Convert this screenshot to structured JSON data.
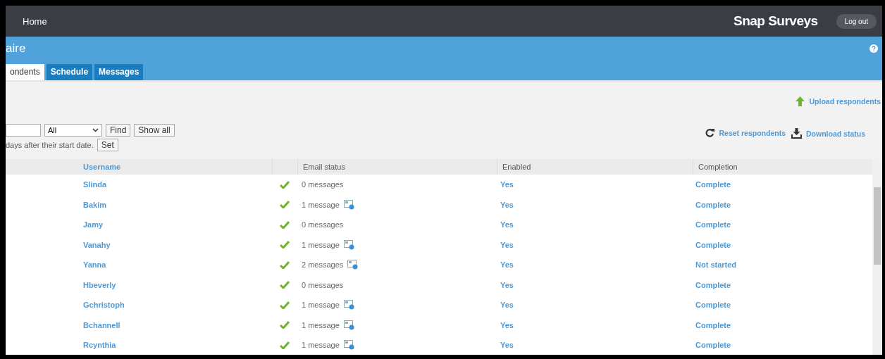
{
  "header": {
    "home": "Home",
    "brand": "Snap Surveys",
    "logout": "Log out"
  },
  "banner": {
    "title": "aire"
  },
  "tabs": [
    {
      "label": "ondents",
      "selected": true
    },
    {
      "label": "Schedule",
      "selected": false
    },
    {
      "label": "Messages",
      "selected": false
    }
  ],
  "actions": {
    "upload": "Upload respondents",
    "reset": "Reset respondents",
    "download": "Download status"
  },
  "filter": {
    "select_value": "All",
    "find": "Find",
    "show_all": "Show all",
    "days_text": "days after their start date.",
    "set": "Set"
  },
  "table": {
    "columns": [
      "Username",
      "Email status",
      "Enabled",
      "Completion"
    ],
    "rows": [
      {
        "username": "Slinda",
        "valid": true,
        "email_status": "0 messages",
        "has_message_icon": false,
        "enabled": "Yes",
        "completion": "Complete"
      },
      {
        "username": "Bakim",
        "valid": true,
        "email_status": "1 message",
        "has_message_icon": true,
        "enabled": "Yes",
        "completion": "Complete"
      },
      {
        "username": "Jamy",
        "valid": true,
        "email_status": "0 messages",
        "has_message_icon": false,
        "enabled": "Yes",
        "completion": "Complete"
      },
      {
        "username": "Vanahy",
        "valid": true,
        "email_status": "1 message",
        "has_message_icon": true,
        "enabled": "Yes",
        "completion": "Complete"
      },
      {
        "username": "Yanna",
        "valid": true,
        "email_status": "2 messages",
        "has_message_icon": true,
        "enabled": "Yes",
        "completion": "Not started"
      },
      {
        "username": "Hbeverly",
        "valid": true,
        "email_status": "0 messages",
        "has_message_icon": false,
        "enabled": "Yes",
        "completion": "Complete"
      },
      {
        "username": "Gchristoph",
        "valid": true,
        "email_status": "1 message",
        "has_message_icon": true,
        "enabled": "Yes",
        "completion": "Complete"
      },
      {
        "username": "Bchannell",
        "valid": true,
        "email_status": "1 message",
        "has_message_icon": true,
        "enabled": "Yes",
        "completion": "Complete"
      },
      {
        "username": "Rcynthia",
        "valid": true,
        "email_status": "1 message",
        "has_message_icon": true,
        "enabled": "Yes",
        "completion": "Complete"
      }
    ]
  }
}
